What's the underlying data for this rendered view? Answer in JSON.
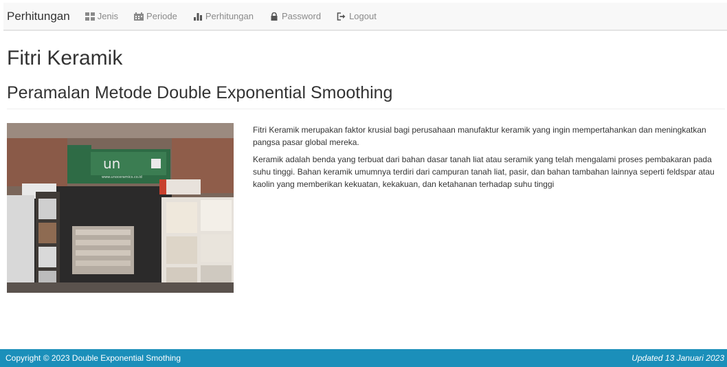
{
  "navbar": {
    "brand": "Perhitungan",
    "items": [
      {
        "label": "Jenis",
        "icon": "th-large-icon"
      },
      {
        "label": "Periode",
        "icon": "calendar-icon"
      },
      {
        "label": "Perhitungan",
        "icon": "bar-chart-icon"
      },
      {
        "label": "Password",
        "icon": "lock-icon"
      },
      {
        "label": "Logout",
        "icon": "log-out-icon"
      }
    ]
  },
  "main": {
    "site_title": "Fitri Keramik",
    "heading": "Peramalan Metode Double Exponential Smoothing",
    "paragraphs": [
      "Fitri Keramik merupakan faktor krusial bagi perusahaan manufaktur keramik yang ingin mempertahankan dan meningkatkan pangsa pasar global mereka.",
      "Keramik adalah benda yang terbuat dari bahan dasar tanah liat atau seramik yang telah mengalami proses pembakaran pada suhu tinggi. Bahan keramik umumnya terdiri dari campuran tanah liat, pasir, dan bahan tambahan lainnya seperti feldspar atau kaolin yang memberikan kekuatan, kekakuan, dan ketahanan terhadap suhu tinggi"
    ],
    "photo_sign": "un",
    "photo_sign_url": "www.unoceramics.co.id"
  },
  "footer": {
    "copyright": "Copyright © 2023 Double Exponential Smothing",
    "updated": "Updated 13 Januari 2023"
  },
  "colors": {
    "footer_bg": "#1b8fba",
    "navbar_bg": "#f8f8f8",
    "nav_text": "#8a8a8a"
  }
}
